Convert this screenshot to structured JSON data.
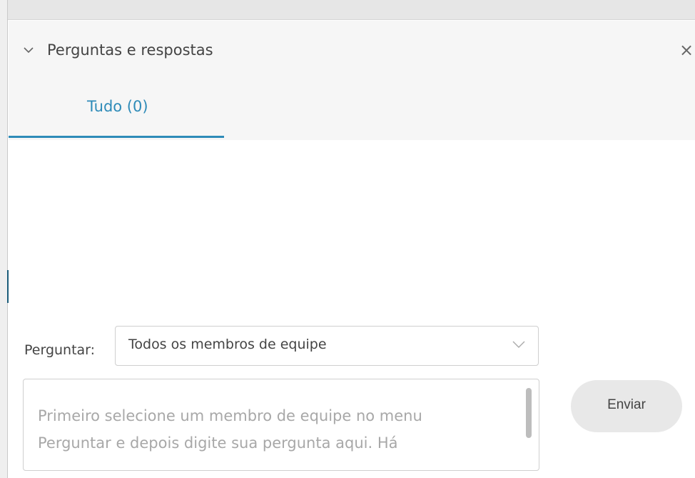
{
  "panel": {
    "title": "Perguntas e respostas",
    "collapse_icon": "chevron-down-icon",
    "close_icon": "close-icon",
    "close_glyph": "×"
  },
  "tabs": [
    {
      "label": "Tudo (0)",
      "active": true
    }
  ],
  "ask": {
    "label": "Perguntar:",
    "selected": "Todos os membros de equipe"
  },
  "question": {
    "placeholder_line1": "Primeiro selecione um membro de equipe no menu",
    "placeholder_line2": "Perguntar e depois digite sua pergunta aqui. Há"
  },
  "send_button": {
    "label": "Enviar"
  },
  "colors": {
    "accent": "#2e8bb8",
    "header_bg": "#f6f6f6",
    "button_bg": "#e8e8e8"
  }
}
